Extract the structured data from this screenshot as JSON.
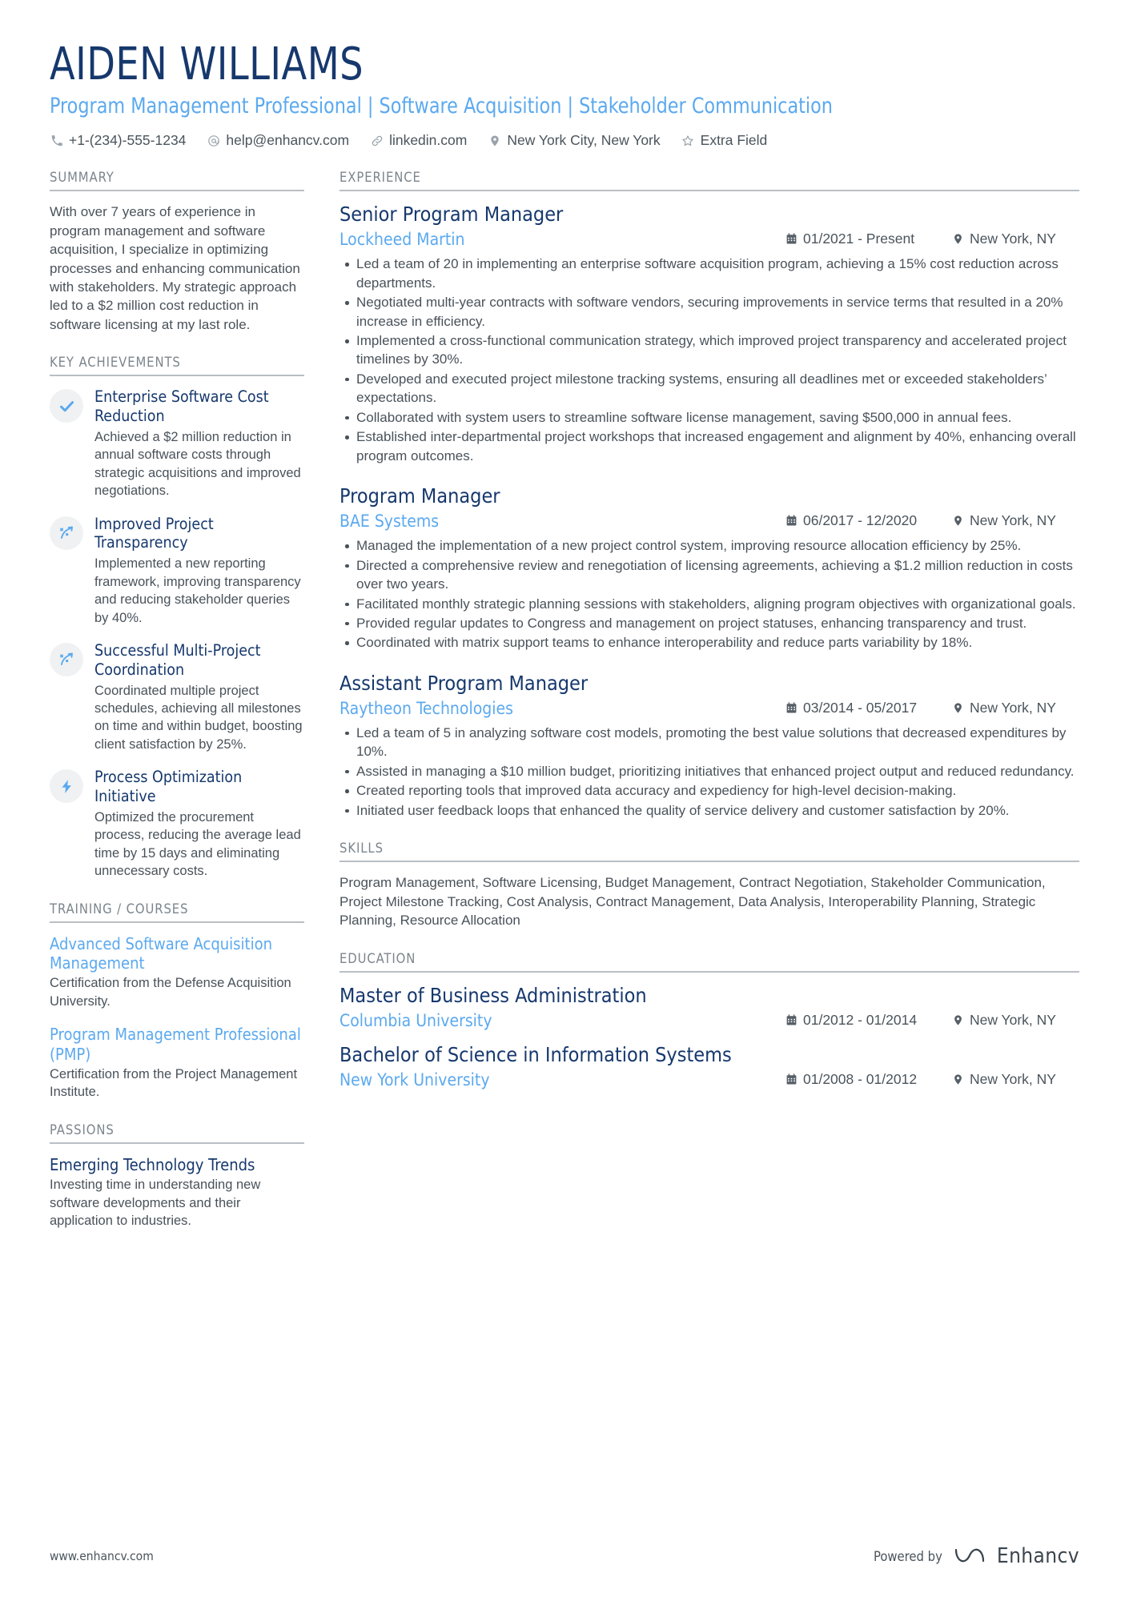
{
  "header": {
    "name": "AIDEN WILLIAMS",
    "title": "Program Management Professional | Software Acquisition | Stakeholder Communication",
    "contacts": [
      {
        "icon": "phone-icon",
        "text": "+1-(234)-555-1234"
      },
      {
        "icon": "email-icon",
        "text": "help@enhancv.com"
      },
      {
        "icon": "link-icon",
        "text": "linkedin.com"
      },
      {
        "icon": "location-pin-icon",
        "text": "New York City, New York"
      },
      {
        "icon": "star-icon",
        "text": "Extra Field"
      }
    ]
  },
  "colors": {
    "navy": "#16386d",
    "light_blue": "#5ba9ef",
    "body_gray": "#49525a",
    "rule_gray": "#b9bfc4",
    "badge_bg": "#f0f1f2"
  },
  "summary": {
    "heading": "SUMMARY",
    "text": "With over 7 years of experience in program management and software acquisition, I specialize in optimizing processes and enhancing communication with stakeholders. My strategic approach led to a $2 million cost reduction in software licensing at my last role."
  },
  "key_achievements": {
    "heading": "KEY ACHIEVEMENTS",
    "items": [
      {
        "icon": "check-icon",
        "title": "Enterprise Software Cost Reduction",
        "description": "Achieved a $2 million reduction in annual software costs through strategic acquisitions and improved negotiations."
      },
      {
        "icon": "rocket-icon",
        "title": "Improved Project Transparency",
        "description": "Implemented a new reporting framework, improving transparency and reducing stakeholder queries by 40%."
      },
      {
        "icon": "rocket-icon",
        "title": "Successful Multi-Project Coordination",
        "description": "Coordinated multiple project schedules, achieving all milestones on time and within budget, boosting client satisfaction by 25%."
      },
      {
        "icon": "lightning-bolt-icon",
        "title": "Process Optimization Initiative",
        "description": "Optimized the procurement process, reducing the average lead time by 15 days and eliminating unnecessary costs."
      }
    ]
  },
  "training": {
    "heading": "TRAINING / COURSES",
    "items": [
      {
        "title": "Advanced Software Acquisition Management",
        "description": "Certification from the Defense Acquisition University."
      },
      {
        "title": "Program Management Professional (PMP)",
        "description": "Certification from the Project Management Institute."
      }
    ]
  },
  "passions": {
    "heading": "PASSIONS",
    "items": [
      {
        "title": "Emerging Technology Trends",
        "description": "Investing time in understanding new software developments and their application to industries."
      }
    ]
  },
  "experience": {
    "heading": "EXPERIENCE",
    "jobs": [
      {
        "title": "Senior Program Manager",
        "company": "Lockheed Martin",
        "date": "01/2021 - Present",
        "location": "New York, NY",
        "bullets": [
          "Led a team of 20 in implementing an enterprise software acquisition program, achieving a 15% cost reduction across departments.",
          "Negotiated multi-year contracts with software vendors, securing improvements in service terms that resulted in a 20% increase in efficiency.",
          "Implemented a cross-functional communication strategy, which improved project transparency and accelerated project timelines by 30%.",
          "Developed and executed project milestone tracking systems, ensuring all deadlines met or exceeded stakeholders’ expectations.",
          "Collaborated with system users to streamline software license management, saving $500,000 in annual fees.",
          "Established inter-departmental project workshops that increased engagement and alignment by 40%, enhancing overall program outcomes."
        ]
      },
      {
        "title": "Program Manager",
        "company": "BAE Systems",
        "date": "06/2017 - 12/2020",
        "location": "New York, NY",
        "bullets": [
          "Managed the implementation of a new project control system, improving resource allocation efficiency by 25%.",
          "Directed a comprehensive review and renegotiation of licensing agreements, achieving a $1.2 million reduction in costs over two years.",
          "Facilitated monthly strategic planning sessions with stakeholders, aligning program objectives with organizational goals.",
          "Provided regular updates to Congress and management on project statuses, enhancing transparency and trust.",
          "Coordinated with matrix support teams to enhance interoperability and reduce parts variability by 18%."
        ]
      },
      {
        "title": "Assistant Program Manager",
        "company": "Raytheon Technologies",
        "date": "03/2014 - 05/2017",
        "location": "New York, NY",
        "bullets": [
          "Led a team of 5 in analyzing software cost models, promoting the best value solutions that decreased expenditures by 10%.",
          "Assisted in managing a $10 million budget, prioritizing initiatives that enhanced project output and reduced redundancy.",
          "Created reporting tools that improved data accuracy and expediency for high-level decision-making.",
          "Initiated user feedback loops that enhanced the quality of service delivery and customer satisfaction by 20%."
        ]
      }
    ]
  },
  "skills": {
    "heading": "SKILLS",
    "text": "Program Management, Software Licensing, Budget Management, Contract Negotiation, Stakeholder Communication, Project Milestone Tracking, Cost Analysis, Contract Management, Data Analysis, Interoperability Planning, Strategic Planning, Resource Allocation"
  },
  "education": {
    "heading": "EDUCATION",
    "items": [
      {
        "degree": "Master of Business Administration",
        "school": "Columbia University",
        "date": "01/2012 - 01/2014",
        "location": "New York, NY"
      },
      {
        "degree": "Bachelor of Science in Information Systems",
        "school": "New York University",
        "date": "01/2008 - 01/2012",
        "location": "New York, NY"
      }
    ]
  },
  "footer": {
    "url": "www.enhancv.com",
    "powered_by": "Powered by",
    "brand": "Enhancv"
  }
}
